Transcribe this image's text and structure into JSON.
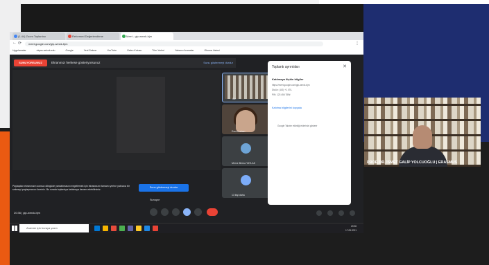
{
  "browser": {
    "tabs": [
      {
        "label": "(1.44) Zoom Toplantısı",
        "color": "#4285f4"
      },
      {
        "label": "Reformed Değerlendirme",
        "color": "#ea4335"
      },
      {
        "label": "Meet - gip-wmxk-bjm",
        "color": "#34a853"
      }
    ],
    "url": "meet.google.com/gip-wmxk-bjm",
    "bookmarks": [
      "Uygulamalar",
      "ekpss.selcuk.edu",
      "Google",
      "Yeni Sekme",
      "YouTube",
      "Gelen Kutusu",
      "Tüm Yerleri",
      "Yabancı Aramalar",
      "Okuma Listesi"
    ]
  },
  "meet": {
    "present_button": "SUNUYORSUNUZ",
    "banner_text": "Ekranınızı herkese gösteriyorsunuz",
    "stop_sharing": "Sunu göstermeyi durdur",
    "participants": [
      {
        "name": "Siz"
      },
      {
        "name": "Esra Kurban"
      },
      {
        "name": "Merve Berna YAYLAK"
      },
      {
        "name": "13 kişi daha"
      }
    ],
    "toast_text": "Paylaşılan ekranınızın sonsuz döngüde yansıtılmasını engellemek için ekranınızın tamamı yerine yalnızca bir sekmeyi paylaşmanızı öneririz. Bu sırada toplantıya katılmaya devam edebilirsiniz.",
    "toast_button": "Sunu göstermeyi durdur",
    "presenting_label": "Sunuyor",
    "clock": "20:36  |  gip-wmxk-bjm"
  },
  "side_panel": {
    "title": "Toplantı ayrıntıları",
    "subtitle": "Katılmaya ilişkin bilgiler",
    "lines": [
      "https://meet.google.com/gip-wmxk-bjm",
      "Dial-in: (US) +1 470-",
      "PIN: 123 456 789#"
    ],
    "link": "Katılma bilgilerini kopyala",
    "note": "Google Takvim etkinliği eklerinizi gösterir"
  },
  "taskbar": {
    "search_placeholder": "Aramak için buraya yazın",
    "time": "20:36",
    "date": "17.05.2021",
    "icon_colors": [
      "#0078d4",
      "#f7b500",
      "#e74c3c",
      "#4caf50",
      "#6264a7",
      "#ffca28",
      "#1e88e5",
      "#ea4335"
    ]
  },
  "speaker": {
    "caption": "PROF. DR. İSMET GALİP YOLCUOĞLU | ERASMUS"
  },
  "colors": {
    "brand_blue": "#1e2d70",
    "brand_orange": "#ea5a12",
    "meet_red": "#ea4335",
    "meet_blue": "#1a73e8"
  }
}
